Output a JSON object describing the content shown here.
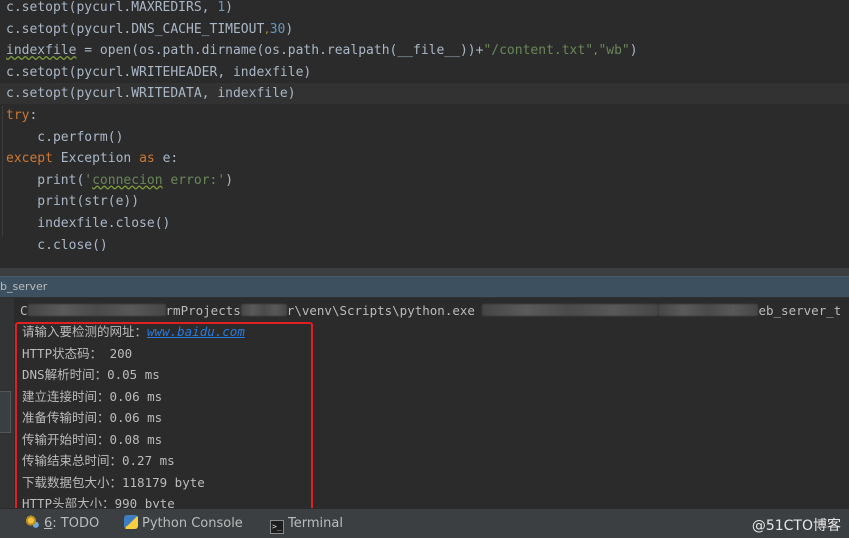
{
  "editor": {
    "lines": [
      {
        "id": "l0",
        "segments": [
          {
            "t": "c.setopt(pycurl.MAXREDIRS, ",
            "c": "fn"
          },
          {
            "t": "1",
            "c": "num"
          },
          {
            "t": ")",
            "c": "fn"
          }
        ]
      },
      {
        "id": "l1",
        "segments": [
          {
            "t": "c.setopt(pycurl.DNS_CACHE_TIMEOUT",
            "c": "fn"
          },
          {
            "t": ",",
            "c": "bulb"
          },
          {
            "t": "30",
            "c": "num"
          },
          {
            "t": ")",
            "c": "fn"
          }
        ]
      },
      {
        "id": "l2",
        "segments": [
          {
            "t": "indexfile",
            "c": "fn squig"
          },
          {
            "t": " = open(os.path.dirname(os.path.realpath(__file__))+",
            "c": "fn"
          },
          {
            "t": "\"/content.txt\"",
            "c": "str"
          },
          {
            "t": ",",
            "c": "bulb"
          },
          {
            "t": "\"wb\"",
            "c": "str"
          },
          {
            "t": ")",
            "c": "fn"
          }
        ]
      },
      {
        "id": "l3",
        "segments": [
          {
            "t": "c.setopt(pycurl.WRITEHEADER, indexfile)",
            "c": "fn"
          }
        ]
      },
      {
        "id": "l4",
        "current": true,
        "segments": [
          {
            "t": "c.setopt(pycurl.WRITEDATA, indexfile)",
            "c": "fn"
          }
        ]
      },
      {
        "id": "l5",
        "segments": [
          {
            "t": "try",
            "c": "kw"
          },
          {
            "t": ":",
            "c": "fn"
          }
        ]
      },
      {
        "id": "l6",
        "segments": [
          {
            "t": "    c.perform()",
            "c": "fn"
          }
        ]
      },
      {
        "id": "l7",
        "segments": [
          {
            "t": "except ",
            "c": "kw"
          },
          {
            "t": "Exception ",
            "c": "fn"
          },
          {
            "t": "as ",
            "c": "kw"
          },
          {
            "t": "e:",
            "c": "fn"
          }
        ]
      },
      {
        "id": "l8",
        "segments": [
          {
            "t": "    print(",
            "c": "fn"
          },
          {
            "t": "'",
            "c": "str"
          },
          {
            "t": "connecion",
            "c": "str squig"
          },
          {
            "t": " error:'",
            "c": "str"
          },
          {
            "t": ")",
            "c": "fn"
          }
        ]
      },
      {
        "id": "l9",
        "segments": [
          {
            "t": "    print(str(e))",
            "c": "fn"
          }
        ]
      },
      {
        "id": "l10",
        "segments": [
          {
            "t": "    indexfile.close()",
            "c": "fn"
          }
        ]
      },
      {
        "id": "l11",
        "segments": [
          {
            "t": "    c.close()",
            "c": "fn"
          }
        ]
      }
    ]
  },
  "run_window": {
    "title": "b_server",
    "command": {
      "prefix": "C",
      "part1": "rmProjects",
      "part2": "r\\venv\\Scripts\\python.exe",
      "suffix": "eb_server_t"
    },
    "output": {
      "prompt_label": "请输入要检测的网址：",
      "url": "www.baidu.com",
      "lines": [
        "HTTP状态码： 200",
        "DNS解析时间：0.05 ms",
        "建立连接时间：0.06 ms",
        "准备传输时间：0.06 ms",
        "传输开始时间：0.08 ms",
        "传输结束总时间：0.27 ms",
        "下载数据包大小：118179 byte",
        "HTTP头部大小：990 byte"
      ]
    }
  },
  "bottom_bar": {
    "todo_num": "6",
    "todo_label": ": TODO",
    "python_console": "Python Console",
    "terminal": "Terminal",
    "watermark": "@51CTO博客"
  }
}
